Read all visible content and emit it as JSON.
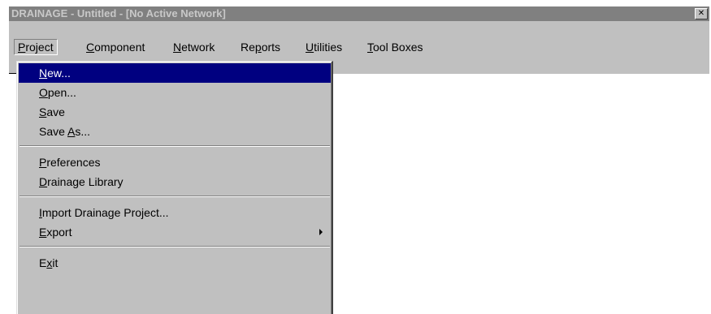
{
  "window": {
    "title": "DRAINAGE - Untitled - [No Active Network]",
    "close_glyph": "✕"
  },
  "menubar": {
    "items": [
      {
        "mnemonic": "P",
        "rest": "roject"
      },
      {
        "mnemonic": "C",
        "rest": "omponent"
      },
      {
        "mnemonic": "N",
        "rest": "etwork"
      },
      {
        "pre": "Re",
        "mnemonic": "p",
        "rest": "orts"
      },
      {
        "mnemonic": "U",
        "rest": "tilities"
      },
      {
        "mnemonic": "T",
        "rest": "ool Boxes"
      }
    ]
  },
  "dropdown": {
    "items": [
      {
        "pre": "",
        "mnemonic": "N",
        "rest": "ew..."
      },
      {
        "pre": "",
        "mnemonic": "O",
        "rest": "pen..."
      },
      {
        "pre": "",
        "mnemonic": "S",
        "rest": "ave"
      },
      {
        "pre": "Save ",
        "mnemonic": "A",
        "rest": "s..."
      },
      {
        "pre": "",
        "mnemonic": "P",
        "rest": "references"
      },
      {
        "pre": "",
        "mnemonic": "D",
        "rest": "rainage Library"
      },
      {
        "pre": "",
        "mnemonic": "I",
        "rest": "mport Drainage Project..."
      },
      {
        "pre": "",
        "mnemonic": "E",
        "rest": "xport"
      },
      {
        "pre": "E",
        "mnemonic": "x",
        "rest": "it"
      }
    ]
  },
  "colors": {
    "highlight": "#000080",
    "face": "#c0c0c0",
    "inactive_title": "#808080"
  }
}
